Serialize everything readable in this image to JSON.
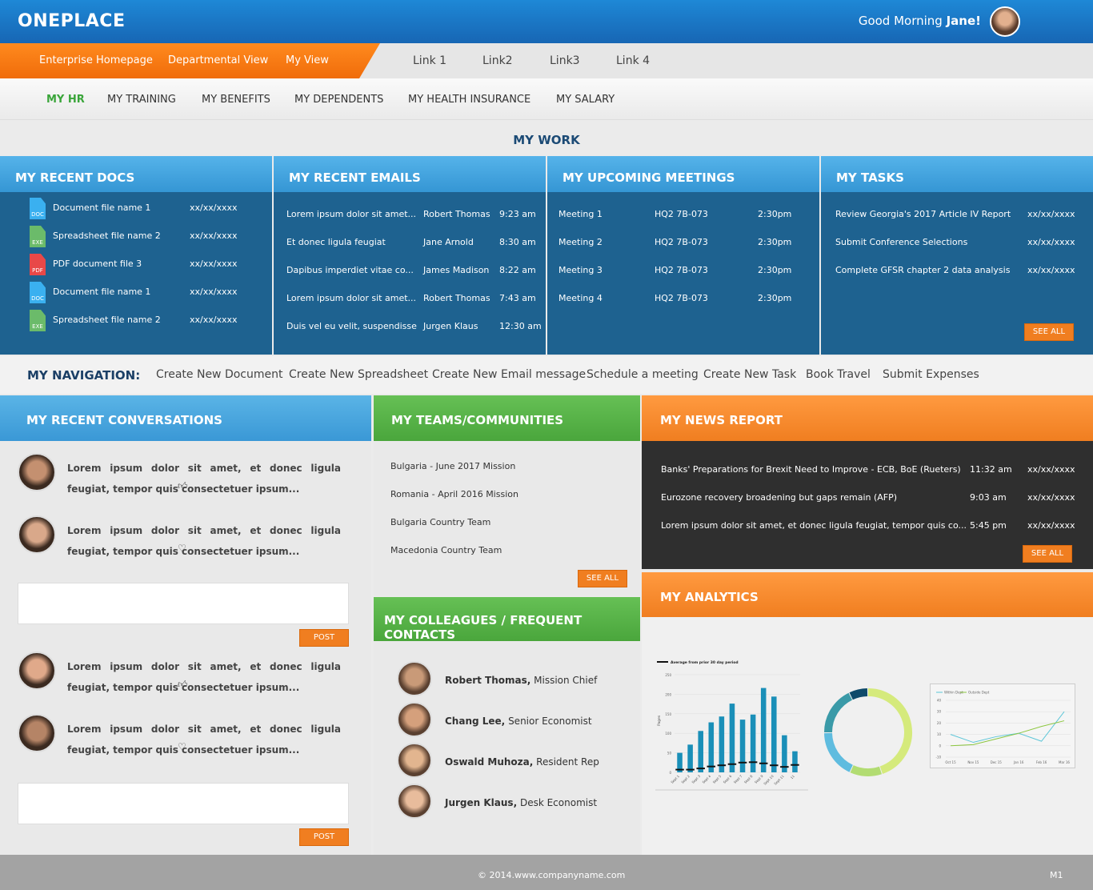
{
  "header": {
    "title": "ONEPLACE",
    "greeting": "Good Morning ",
    "user": "Jane!"
  },
  "primary_nav": [
    "Enterprise Homepage",
    "Departmental View",
    "My View"
  ],
  "links": [
    "Link 1",
    "Link2",
    "Link3",
    "Link 4"
  ],
  "sub_nav": [
    "MY HR",
    "MY TRAINING",
    "MY BENEFITS",
    "MY DEPENDENTS",
    "MY HEALTH INSURANCE",
    "MY SALARY"
  ],
  "my_work_title": "MY WORK",
  "recent_docs": {
    "title": "MY RECENT DOCS",
    "items": [
      {
        "type": "DOC",
        "name": "Document file name 1",
        "date": "xx/xx/xxxx"
      },
      {
        "type": "EXE",
        "name": "Spreadsheet file name 2",
        "date": "xx/xx/xxxx"
      },
      {
        "type": "PDF",
        "name": "PDF document file 3",
        "date": "xx/xx/xxxx"
      },
      {
        "type": "DOC",
        "name": "Document file name 1",
        "date": "xx/xx/xxxx"
      },
      {
        "type": "EXE",
        "name": "Spreadsheet file name 2",
        "date": "xx/xx/xxxx"
      }
    ]
  },
  "recent_emails": {
    "title": "MY RECENT EMAILS",
    "items": [
      {
        "subject": "Lorem ipsum dolor sit amet...",
        "from": "Robert Thomas",
        "time": "9:23 am"
      },
      {
        "subject": "Et donec ligula feugiat",
        "from": "Jane Arnold",
        "time": "8:30 am"
      },
      {
        "subject": "Dapibus imperdiet vitae co...",
        "from": "James Madison",
        "time": "8:22 am"
      },
      {
        "subject": "Lorem ipsum dolor sit amet...",
        "from": "Robert Thomas",
        "time": "7:43 am"
      },
      {
        "subject": "Duis vel eu velit, suspendisse",
        "from": "Jurgen Klaus",
        "time": "12:30 am"
      }
    ]
  },
  "meetings": {
    "title": "MY UPCOMING MEETINGS",
    "items": [
      {
        "name": "Meeting 1",
        "room": "HQ2 7B-073",
        "time": "2:30pm"
      },
      {
        "name": "Meeting 2",
        "room": "HQ2 7B-073",
        "time": "2:30pm"
      },
      {
        "name": "Meeting 3",
        "room": "HQ2 7B-073",
        "time": "2:30pm"
      },
      {
        "name": "Meeting 4",
        "room": "HQ2 7B-073",
        "time": "2:30pm"
      }
    ]
  },
  "tasks": {
    "title": "MY TASKS",
    "see_all": "SEE ALL",
    "items": [
      {
        "name": "Review Georgia's 2017 Article IV Report",
        "date": "xx/xx/xxxx"
      },
      {
        "name": "Submit Conference Selections",
        "date": "xx/xx/xxxx"
      },
      {
        "name": "Complete GFSR chapter 2 data analysis",
        "date": "xx/xx/xxxx"
      }
    ]
  },
  "my_navigation": {
    "label": "MY NAVIGATION:",
    "items": [
      "Create New Document",
      "Create New Spreadsheet",
      "Create New Email message",
      "Schedule a meeting",
      "Create New Task",
      "Book Travel",
      "Submit Expenses"
    ]
  },
  "conversations": {
    "title": "MY RECENT CONVERSATIONS",
    "post": "POST",
    "text": "Lorem ipsum dolor sit amet, et donec ligula feugiat, tempor quis consectetuer ipsum..."
  },
  "teams": {
    "title": "MY TEAMS/COMMUNITIES",
    "see_all": "SEE ALL",
    "items": [
      "Bulgaria - June 2017 Mission",
      "Romania - April 2016 Mission",
      "Bulgaria Country Team",
      "Macedonia Country Team"
    ]
  },
  "colleagues": {
    "title": "MY COLLEAGUES / FREQUENT CONTACTS",
    "items": [
      {
        "name": "Robert Thomas,",
        "role": " Mission Chief"
      },
      {
        "name": "Chang Lee,",
        "role": " Senior Economist"
      },
      {
        "name": "Oswald Muhoza,",
        "role": " Resident Rep"
      },
      {
        "name": "Jurgen Klaus,",
        "role": " Desk Economist"
      }
    ]
  },
  "news": {
    "title": "MY NEWS REPORT",
    "see_all": "SEE ALL",
    "items": [
      {
        "headline": "Banks' Preparations for Brexit Need to Improve - ECB, BoE (Rueters)",
        "time": "11:32 am",
        "date": "xx/xx/xxxx"
      },
      {
        "headline": "Eurozone recovery broadening but gaps remain (AFP)",
        "time": "9:03 am",
        "date": "xx/xx/xxxx"
      },
      {
        "headline": "Lorem ipsum dolor sit amet, et donec ligula feugiat, tempor quis co...",
        "time": "5:45 pm",
        "date": "xx/xx/xxxx"
      }
    ]
  },
  "analytics": {
    "title": "MY ANALYTICS"
  },
  "chart_data": [
    {
      "type": "bar",
      "legend": "Average from prior 30 day period",
      "ylabel": "Pages",
      "ylim": [
        0,
        250
      ],
      "yticks": [
        0,
        50,
        100,
        150,
        200,
        250
      ],
      "categories": [
        "Sept 1",
        "Sept 2",
        "Sept 3",
        "Sept 4",
        "Sept 5",
        "Sept 6",
        "Sept 7",
        "Sept 8",
        "Sept 9",
        "Sept 10",
        "Sept 11",
        "11"
      ],
      "values": [
        50,
        71,
        106,
        128,
        143,
        176,
        135,
        148,
        216,
        194,
        95,
        54
      ],
      "average": [
        7,
        7,
        10,
        15,
        18,
        21,
        25,
        26,
        23,
        18,
        14,
        19
      ],
      "colors": {
        "bar": "#1a8fb8",
        "avg": "#111111"
      }
    },
    {
      "type": "pie",
      "donut": true,
      "values": [
        45,
        12,
        18,
        18,
        7
      ],
      "colors": [
        "#d5ea7c",
        "#b2dc72",
        "#5fbcdf",
        "#3a9aa8",
        "#0f4a6a"
      ]
    },
    {
      "type": "line",
      "xlabels": [
        "Oct 15",
        "Nov 15",
        "Dec 15",
        "Jan 16",
        "Feb 16",
        "Mar 16"
      ],
      "ylim": [
        -10,
        40
      ],
      "yticks": [
        -10,
        0,
        10,
        20,
        30,
        40
      ],
      "series": [
        {
          "name": "Within Dept",
          "values": [
            10,
            3,
            8,
            11,
            4,
            30
          ],
          "color": "#5cc6d8"
        },
        {
          "name": "Outside Dept",
          "values": [
            0,
            1,
            6,
            11,
            17,
            22
          ],
          "color": "#8cc63f"
        }
      ]
    }
  ],
  "footer": {
    "copyright": "© 2014.www.companyname.com",
    "code": "M1"
  },
  "colors": {
    "blue": "#1e6290",
    "orange": "#f07e20",
    "green": "#5cb85c"
  }
}
